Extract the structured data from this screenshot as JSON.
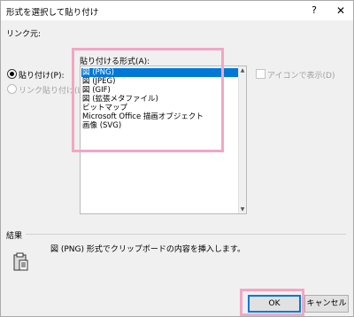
{
  "window": {
    "title": "形式を選択して貼り付け",
    "help": "?",
    "close": "✕"
  },
  "source_label": "リンク元:",
  "paste_options": {
    "paste_label": "貼り付け(P):",
    "paste_link_label": "リンク貼り付け(L):"
  },
  "format": {
    "label": "貼り付ける形式(A):",
    "items": [
      "図 (PNG)",
      "図 (JPEG)",
      "図 (GIF)",
      "図 (拡張メタファイル)",
      "ビットマップ",
      "Microsoft Office 描画オブジェクト",
      "画像 (SVG)"
    ],
    "selected_index": 0
  },
  "display_as_icon_label": "アイコンで表示(D)",
  "result": {
    "label": "結果",
    "description": "図 (PNG) 形式でクリップボードの内容を挿入します。"
  },
  "buttons": {
    "ok": "OK",
    "cancel": "キャンセル"
  },
  "colors": {
    "selection": "#0078d7",
    "highlight_annotation": "#f2a7c4"
  }
}
